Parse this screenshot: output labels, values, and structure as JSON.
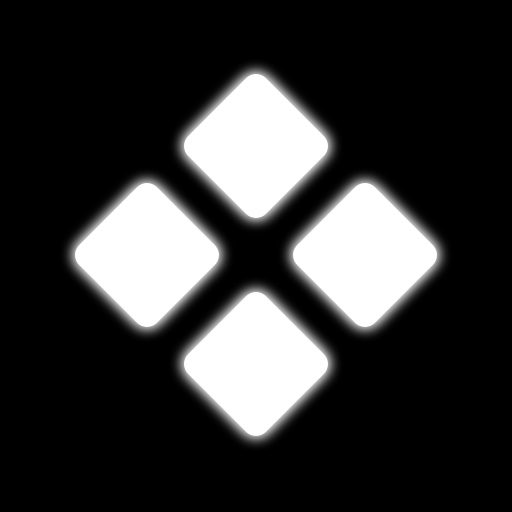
{
  "app_icon": {
    "icon": "four-diamond-tiles-icon",
    "background_color": "#000000",
    "tile_color": "#ffffff",
    "glow_color": "#ffffff",
    "tiles": [
      "top",
      "left",
      "right",
      "bottom"
    ]
  }
}
